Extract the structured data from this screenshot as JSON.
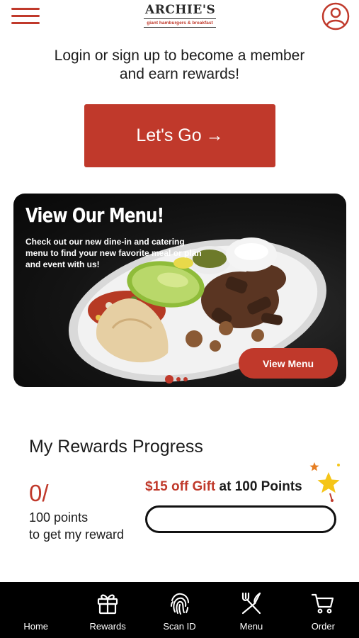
{
  "header": {
    "logo_name": "ARCHIE'S",
    "logo_tagline": "giant hamburgers & breakfast"
  },
  "login": {
    "prompt_line1": "Login or sign up to become a member",
    "prompt_line2": "and earn rewards!",
    "button_label": "Let's Go",
    "button_arrow": "→"
  },
  "menu_card": {
    "title": "View Our Menu!",
    "description": "Check out our new dine-in and catering menu to find your new favorite meal or plan and event with us!",
    "button_label": "View Menu",
    "carousel": {
      "count": 3,
      "active": 0
    }
  },
  "rewards": {
    "title": "My Rewards Progress",
    "points_value": "0/",
    "points_line1": "100 points",
    "points_line2": "to get my reward",
    "gift_amount": "$15 off Gift",
    "gift_suffix": "at 100 Points",
    "progress_fraction": 0
  },
  "nav": {
    "items": [
      {
        "label": "Home",
        "icon": "home-icon"
      },
      {
        "label": "Rewards",
        "icon": "gift-icon"
      },
      {
        "label": "Scan ID",
        "icon": "fingerprint-icon"
      },
      {
        "label": "Menu",
        "icon": "fork-knife-icon"
      },
      {
        "label": "Order",
        "icon": "cart-icon"
      }
    ]
  },
  "colors": {
    "brand_red": "#c0392b",
    "nav_background": "#000000",
    "star_yellow": "#f5c518"
  }
}
